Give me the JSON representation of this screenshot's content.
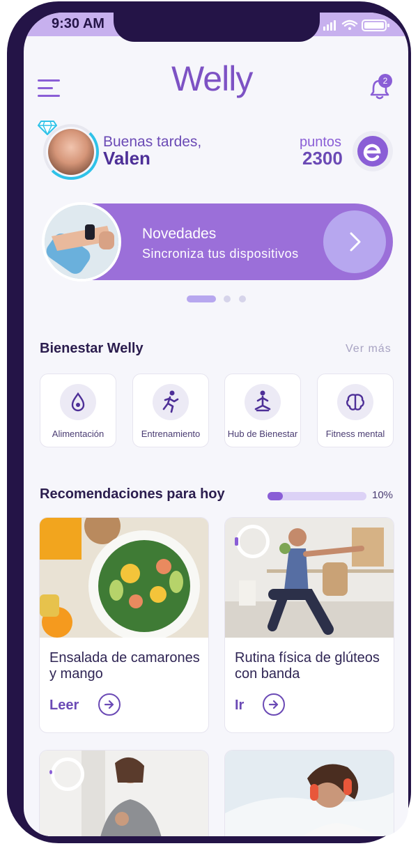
{
  "status_bar": {
    "time": "9:30 AM"
  },
  "header": {
    "logo": "Welly",
    "notifications_count": "2"
  },
  "user": {
    "greeting": "Buenas tardes,",
    "name": "Valen"
  },
  "points": {
    "label": "puntos",
    "value": "2300"
  },
  "banner": {
    "title": "Novedades",
    "subtitle": "Sincroniza tus dispositivos"
  },
  "wellness": {
    "title": "Bienestar Welly",
    "see_more": "Ver más",
    "categories": [
      {
        "label": "Alimentación",
        "icon": "drop-icon"
      },
      {
        "label": "Entrenamiento",
        "icon": "running-person-icon"
      },
      {
        "label": "Hub de Bienestar",
        "icon": "meditation-icon"
      },
      {
        "label": "Fitness mental",
        "icon": "brain-icon"
      }
    ]
  },
  "recommendations": {
    "title": "Recomendaciones para hoy",
    "progress_percent": 10,
    "progress_label": "10%",
    "cards": [
      {
        "title": "Ensalada de camarones y mango",
        "action": "Leer"
      },
      {
        "title": "Rutina física de glúteos con banda",
        "action": "Ir"
      }
    ]
  },
  "colors": {
    "accent": "#8a5ed6",
    "dark": "#241447",
    "banner": "#9b6fd9",
    "cyan": "#2fc2e8"
  }
}
